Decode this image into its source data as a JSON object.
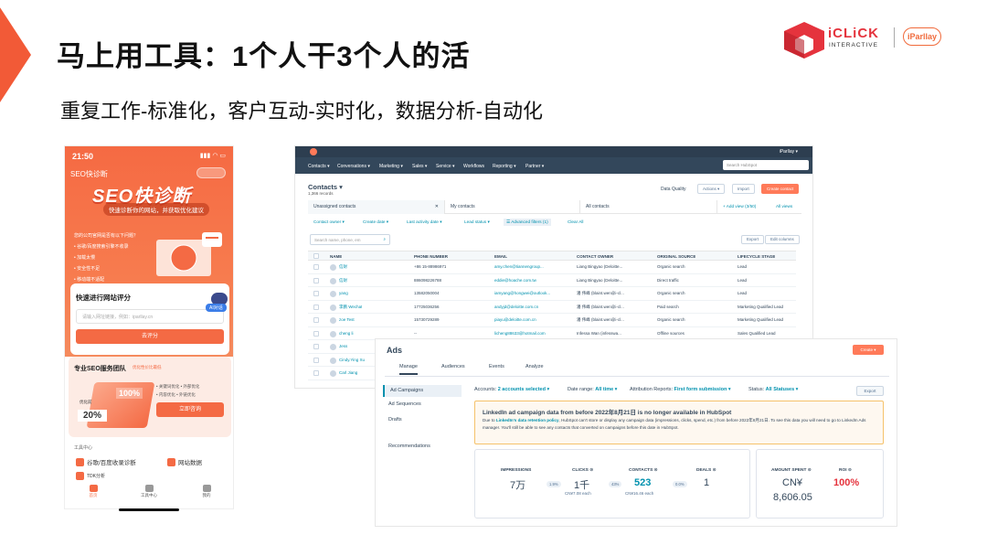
{
  "slide": {
    "title": "马上用工具：1个人干3个人的活",
    "subtitle": "重复工作-标准化，客户互动-实时化，数据分析-自动化",
    "accent_color": "#f25a37"
  },
  "logos": {
    "iclick_top": "iCLiCK",
    "iclick_bottom": "INTERACTIVE",
    "iparllay": "iParllay"
  },
  "phone": {
    "time": "21:50",
    "status_icons": "▮▮▮ ◠ ▭",
    "app_name": "SEO快诊断",
    "hero": "SEO快诊断",
    "hero_tag": "快速诊断你的网站，并获取优化建议",
    "hero_list": [
      "您的公司官网是否有以下问题？",
      "• 谷歌/百度搜索引擎不收录",
      "• 加载太慢",
      "• 安全性不足",
      "• 移动端不适配"
    ],
    "card_title": "快速进行网站评分",
    "input_placeholder": "请输入网址链接，例如：iparllay.cn",
    "score_button": "去评分",
    "ai_label": "AI对话",
    "team_title": "专业SEO服务团队",
    "team_tag": "优化性价比最低",
    "team_100": "100%",
    "team_20": "20%",
    "team_opt": "优化前",
    "team_features": [
      "• 关键词优化",
      "• 内容优化",
      "• 外部优化",
      "• 外链优化"
    ],
    "consult_button": "立即咨询",
    "tools_title": "工具中心",
    "tools": [
      "谷歌/百度收录诊断",
      "网站数据",
      "TDK分析"
    ],
    "tabs": [
      "首页",
      "工具中心",
      "我的"
    ]
  },
  "hubspot": {
    "nav": [
      "Contacts ▾",
      "Conversations ▾",
      "Marketing ▾",
      "Sales ▾",
      "Service ▾",
      "Workflows",
      "Reporting ▾",
      "Partner ▾"
    ],
    "account": "iParllay ▾",
    "search_placeholder": "Search HubSpot",
    "heading": "Contacts ▾",
    "records": "1,366 records",
    "data_quality": "Data Quality",
    "actions": "Actions ▾",
    "import": "Import",
    "create": "Create contact",
    "tabs": [
      "Unassigned contacts",
      "My contacts",
      "All contacts"
    ],
    "add_view": "+ Add view (3/50)",
    "all_views": "All views",
    "filters": [
      "Contact owner ▾",
      "Create date ▾",
      "Last activity date ▾",
      "Lead status ▾",
      "☰ Advanced filters (1)",
      "Clear All"
    ],
    "search_name": "Search name, phone, em",
    "export": "Export",
    "edit_columns": "Edit columns",
    "columns": [
      "NAME",
      "PHONE NUMBER",
      "EMAIL",
      "CONTACT OWNER",
      "ORIGINAL SOURCE",
      "LIFECYCLE STAGE"
    ],
    "rows": [
      [
        "信財",
        "+86 15-88986971",
        "amy.chen@tiannengroup...",
        "Liang Bingyao (Deloitte...",
        "Organic search",
        "Lead"
      ],
      [
        "信財",
        "886098226788",
        "eddie@hoache.com.tw",
        "Liang Bingyao (Deloitte...",
        "Direct traffic",
        "Lead"
      ],
      [
        "yang",
        "13582050004",
        "iamyang@hongwei@outlook...",
        "潘 伟峰 (blaint.wen@i-cl...",
        "Organic search",
        "Lead"
      ],
      [
        "李鹏 Wechat",
        "17725036256",
        "andyjd@deloitte.com.cn",
        "潘 伟峰 (blaint.wen@i-cl...",
        "Paid search",
        "Marketing Qualified Lead"
      ],
      [
        "zoe Test",
        "15730729289",
        "piayu@deloitte.com.cn",
        "潘 伟峰 (blaint.wen@i-cl...",
        "Organic search",
        "Marketing Qualified Lead"
      ],
      [
        "cheng li",
        "--",
        "licheng88633@hotmail.com",
        "Infessa Wan (infesswa...",
        "Offline sources",
        "Sales Qualified Lead"
      ],
      [
        "Jess",
        "",
        "",
        "",
        "",
        ""
      ],
      [
        "Cindy.Ying Xu",
        "",
        "",
        "",
        "",
        ""
      ],
      [
        "Carl Jiang",
        "",
        "",
        "",
        "",
        ""
      ]
    ]
  },
  "ads": {
    "title": "Ads",
    "create": "Create ▾",
    "tabs": [
      "Manage",
      "Audiences",
      "Events",
      "Analyze"
    ],
    "sidebar": [
      "Ad Campaigns",
      "Ad Sequences",
      "Drafts",
      "Recommendations"
    ],
    "filters": {
      "accounts_label": "Accounts:",
      "accounts_value": "2 accounts selected ▾",
      "date_label": "Date range:",
      "date_value": "All time ▾",
      "attr_label": "Attribution Reports:",
      "attr_value": "First form submission ▾",
      "status_label": "Status:",
      "status_value": "All Statuses ▾"
    },
    "export": "Export",
    "alert_title": "LinkedIn ad campaign data from before 2022年8月21日 is no longer available in HubSpot",
    "alert_pre": "Due to ",
    "alert_link": "LinkedIn's data retention policy",
    "alert_rest": ", HubSpot can't store or display any campaign data (impressions, clicks, spend, etc.) from before 2022年8月21日. To see this data you will need to go to LinkedIn Ads manager. You'll still be able to see any contacts that converted on campaigns before this date in HubSpot.",
    "metrics": {
      "impressions_label": "IMPRESSIONS",
      "impressions": "7万",
      "rate1": "1.9%",
      "clicks_label": "CLICKS ⊙",
      "clicks": "1千",
      "clicks_sub": "CN¥7.08 each",
      "rate2": "43%",
      "contacts_label": "CONTACTS ⊙",
      "contacts": "523",
      "contacts_sub": "CN¥16.46 each",
      "rate3": "0.0%",
      "deals_label": "DEALS ⊙",
      "deals": "1",
      "spent_label": "AMOUNT SPENT ⊙",
      "spent_cur": "CN¥",
      "spent": "8,606.05",
      "roi_label": "ROI ⊙",
      "roi": "100%"
    }
  }
}
